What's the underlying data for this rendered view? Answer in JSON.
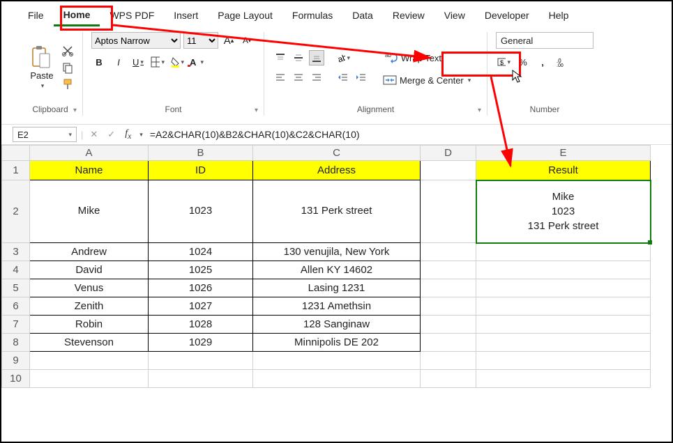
{
  "menu": {
    "file": "File",
    "home": "Home",
    "wpspdf": "WPS PDF",
    "insert": "Insert",
    "pagelayout": "Page Layout",
    "formulas": "Formulas",
    "data": "Data",
    "review": "Review",
    "view": "View",
    "developer": "Developer",
    "help": "Help"
  },
  "ribbon": {
    "clipboard": {
      "paste": "Paste",
      "label": "Clipboard"
    },
    "font": {
      "name": "Aptos Narrow",
      "size": "11",
      "bold": "B",
      "italic": "I",
      "underline": "U",
      "label": "Font"
    },
    "alignment": {
      "wrap": "Wrap Text",
      "merge": "Merge & Center",
      "label": "Alignment"
    },
    "number": {
      "format": "General",
      "label": "Number"
    }
  },
  "formula_bar": {
    "cell": "E2",
    "formula": "=A2&CHAR(10)&B2&CHAR(10)&C2&CHAR(10)"
  },
  "columns": [
    "A",
    "B",
    "C",
    "D",
    "E"
  ],
  "headers": {
    "name": "Name",
    "id": "ID",
    "address": "Address",
    "result": "Result"
  },
  "rows": [
    {
      "name": "Mike",
      "id": "1023",
      "address": "131 Perk street"
    },
    {
      "name": "Andrew",
      "id": "1024",
      "address": "130 venujila, New York"
    },
    {
      "name": "David",
      "id": "1025",
      "address": "Allen KY 14602"
    },
    {
      "name": "Venus",
      "id": "1026",
      "address": "Lasing 1231"
    },
    {
      "name": "Zenith",
      "id": "1027",
      "address": "1231 Amethsin"
    },
    {
      "name": "Robin",
      "id": "1028",
      "address": "128 Sanginaw"
    },
    {
      "name": "Stevenson",
      "id": "1029",
      "address": "Minnipolis DE 202"
    }
  ],
  "result_cell": "Mike\n1023\n131 Perk street"
}
